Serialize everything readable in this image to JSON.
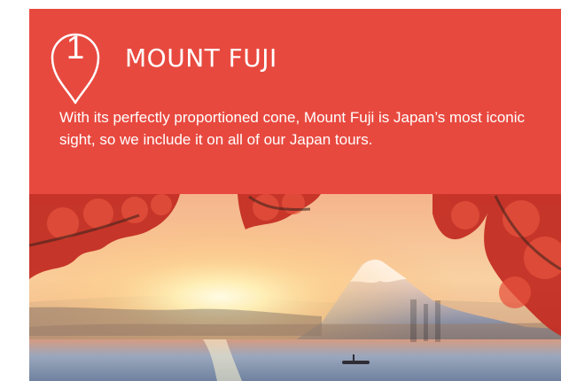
{
  "attraction": {
    "number": "1",
    "title": "MOUNT FUJI",
    "description": "With its perfectly proportioned cone, Mount Fuji is Japan’s most iconic sight, so we include it on all of our Japan tours."
  },
  "colors": {
    "accent": "#e8493f",
    "text": "#ffffff"
  },
  "icons": {
    "marker": "map-pin-icon"
  },
  "image": {
    "subject": "Mount Fuji at sunrise framed by red autumn maple leaves over a lake with a small boat"
  }
}
